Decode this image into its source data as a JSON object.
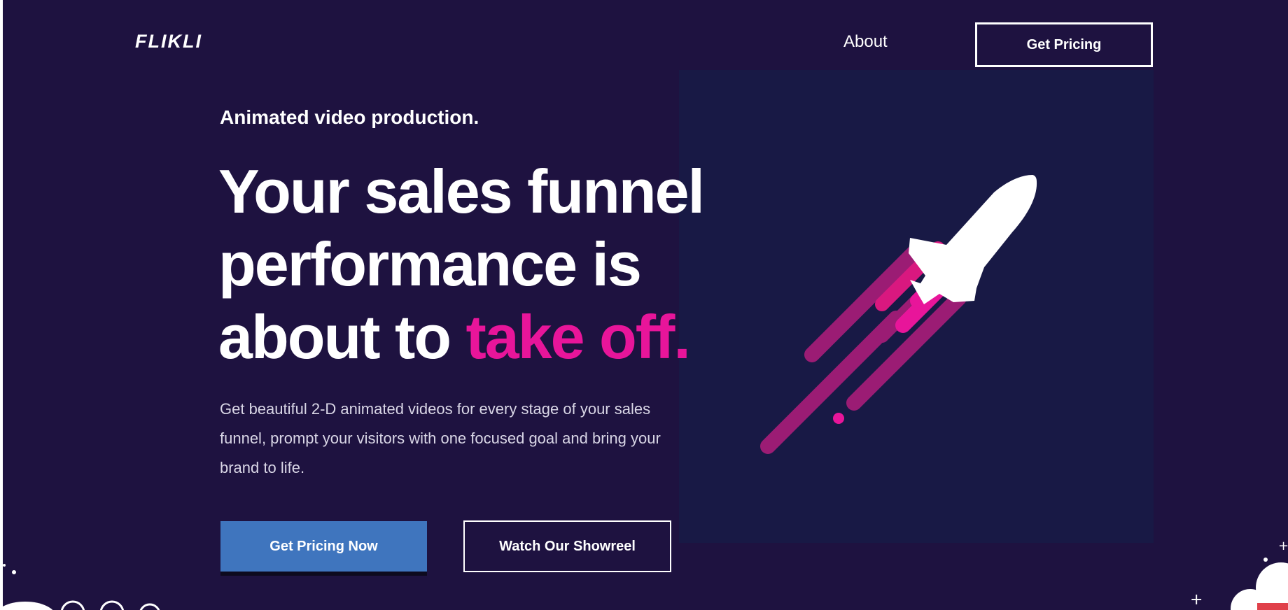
{
  "header": {
    "logo": "FLIKLI",
    "nav_about": "About",
    "nav_pricing": "Get Pricing"
  },
  "hero": {
    "eyebrow": "Animated video production.",
    "headline_part1": "Your sales funnel performance is about to ",
    "headline_accent": "take off.",
    "description": "Get beautiful 2-D animated videos for every stage of your sales funnel, prompt your visitors with one focused goal and bring your brand to life.",
    "primary_button": "Get Pricing Now",
    "secondary_button": "Watch Our Showreel"
  },
  "icons": {
    "illustration": "rocket-icon",
    "decor_left": "cloud-icon",
    "decor_right": "cloud-icon"
  },
  "colors": {
    "background": "#1e1240",
    "illustration_panel": "#181945",
    "accent_pink": "#e8159a",
    "trail_magenta": "#9b1c74",
    "primary_button": "#3f75be"
  }
}
